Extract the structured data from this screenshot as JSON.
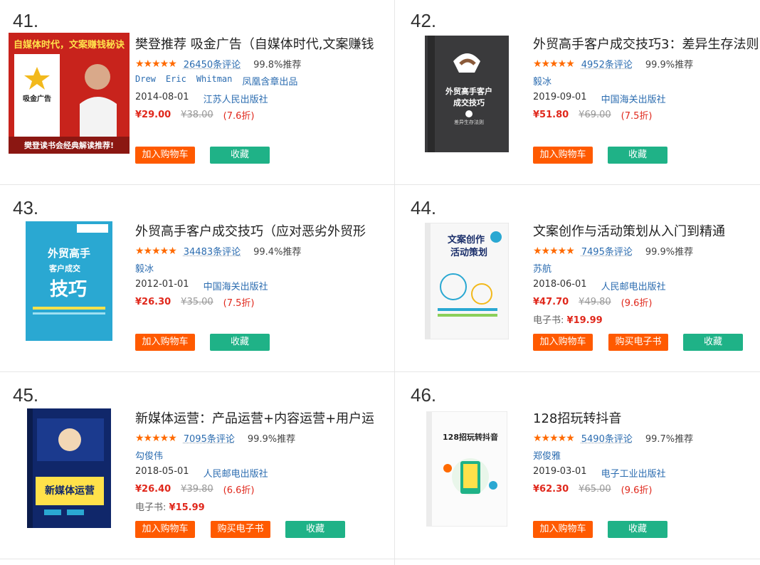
{
  "items": [
    {
      "rank": "41.",
      "title": "樊登推荐 吸金广告（自媒体时代,文案赚钱",
      "stars": "★★★★★",
      "reviews": "26450条评论",
      "recommend": "99.8%推荐",
      "authors": [
        "Drew",
        "Eric",
        "Whitman"
      ],
      "publisher_brand": "凤凰含章出品",
      "date": "2014-08-01",
      "publisher": "江苏人民出版社",
      "price": "¥29.00",
      "original": "¥38.00",
      "discount": "(7.6折)",
      "cart": "加入购物车",
      "fav": "收藏",
      "cover": {
        "banner": "自媒体时代，文案赚钱秘诀",
        "book": "吸金广告",
        "footer": "樊登读书会经典解读推荐!"
      }
    },
    {
      "rank": "42.",
      "title": "外贸高手客户成交技巧3：差异生存法则",
      "stars": "★★★★★",
      "reviews": "4952条评论",
      "recommend": "99.9%推荐",
      "authors": [
        "毅冰"
      ],
      "date": "2019-09-01",
      "publisher": "中国海关出版社",
      "price": "¥51.80",
      "original": "¥69.00",
      "discount": "(7.5折)",
      "cart": "加入购物车",
      "fav": "收藏",
      "cover": {
        "title1": "外贸高手客户",
        "title2": "成交技巧",
        "sub": "差异生存法则"
      }
    },
    {
      "rank": "43.",
      "title": "外贸高手客户成交技巧（应对恶劣外贸形",
      "stars": "★★★★★",
      "reviews": "34483条评论",
      "recommend": "99.4%推荐",
      "authors": [
        "毅冰"
      ],
      "date": "2012-01-01",
      "publisher": "中国海关出版社",
      "price": "¥26.30",
      "original": "¥35.00",
      "discount": "(7.5折)",
      "cart": "加入购物车",
      "fav": "收藏",
      "cover": {
        "title1": "外贸高手",
        "title2": "客户成交",
        "title3": "技巧"
      }
    },
    {
      "rank": "44.",
      "title": "文案创作与活动策划从入门到精通",
      "stars": "★★★★★",
      "reviews": "7495条评论",
      "recommend": "99.9%推荐",
      "authors": [
        "苏航"
      ],
      "date": "2018-06-01",
      "publisher": "人民邮电出版社",
      "price": "¥47.70",
      "original": "¥49.80",
      "discount": "(9.6折)",
      "ebook_label": "电子书:",
      "ebook_price": "¥19.99",
      "cart": "加入购物车",
      "buy_ebook": "购买电子书",
      "fav": "收藏",
      "cover": {
        "title1": "文案创作",
        "title2": "活动策划"
      }
    },
    {
      "rank": "45.",
      "title": "新媒体运营：产品运营+内容运营+用户运",
      "stars": "★★★★★",
      "reviews": "7095条评论",
      "recommend": "99.9%推荐",
      "authors": [
        "勾俊伟"
      ],
      "date": "2018-05-01",
      "publisher": "人民邮电出版社",
      "price": "¥26.40",
      "original": "¥39.80",
      "discount": "(6.6折)",
      "ebook_label": "电子书:",
      "ebook_price": "¥15.99",
      "cart": "加入购物车",
      "buy_ebook": "购买电子书",
      "fav": "收藏",
      "cover": {
        "title": "新媒体运营"
      }
    },
    {
      "rank": "46.",
      "title": "128招玩转抖音",
      "stars": "★★★★★",
      "reviews": "5490条评论",
      "recommend": "99.7%推荐",
      "authors": [
        "郑俊雅"
      ],
      "date": "2019-03-01",
      "publisher": "电子工业出版社",
      "price": "¥62.30",
      "original": "¥65.00",
      "discount": "(9.6折)",
      "cart": "加入购物车",
      "fav": "收藏",
      "cover": {
        "title": "128招玩转抖音"
      }
    }
  ],
  "colors": {
    "accent": "#ff5a00",
    "fav": "#1fb287",
    "price": "#e0281c",
    "link": "#2b6cb0",
    "star": "#ff6a00"
  }
}
